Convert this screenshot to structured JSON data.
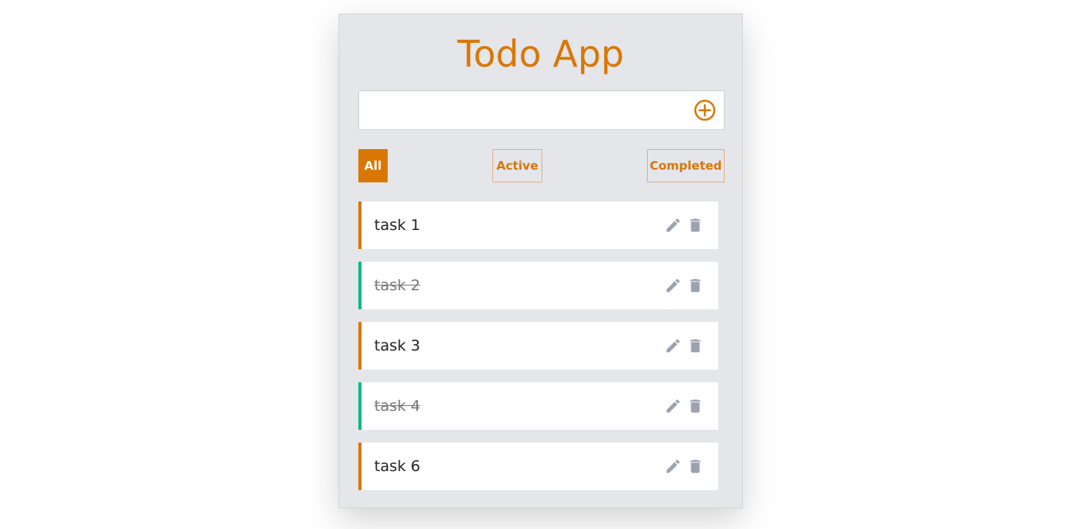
{
  "app": {
    "title": "Todo App"
  },
  "new_task": {
    "value": "",
    "placeholder": "",
    "add_icon": "plus-circle-icon"
  },
  "filters": {
    "all": "All",
    "active": "Active",
    "completed": "Completed",
    "selected": "All"
  },
  "tasks": [
    {
      "label": "task 1",
      "completed": false
    },
    {
      "label": "task 2",
      "completed": true
    },
    {
      "label": "task 3",
      "completed": false
    },
    {
      "label": "task 4",
      "completed": true
    },
    {
      "label": "task 6",
      "completed": false
    }
  ],
  "icons": {
    "edit": "pencil-icon",
    "delete": "trash-icon"
  },
  "colors": {
    "accent": "#d97706",
    "done": "#10b981",
    "icon": "#9ca3af",
    "card_bg": "#e5e6ea"
  }
}
